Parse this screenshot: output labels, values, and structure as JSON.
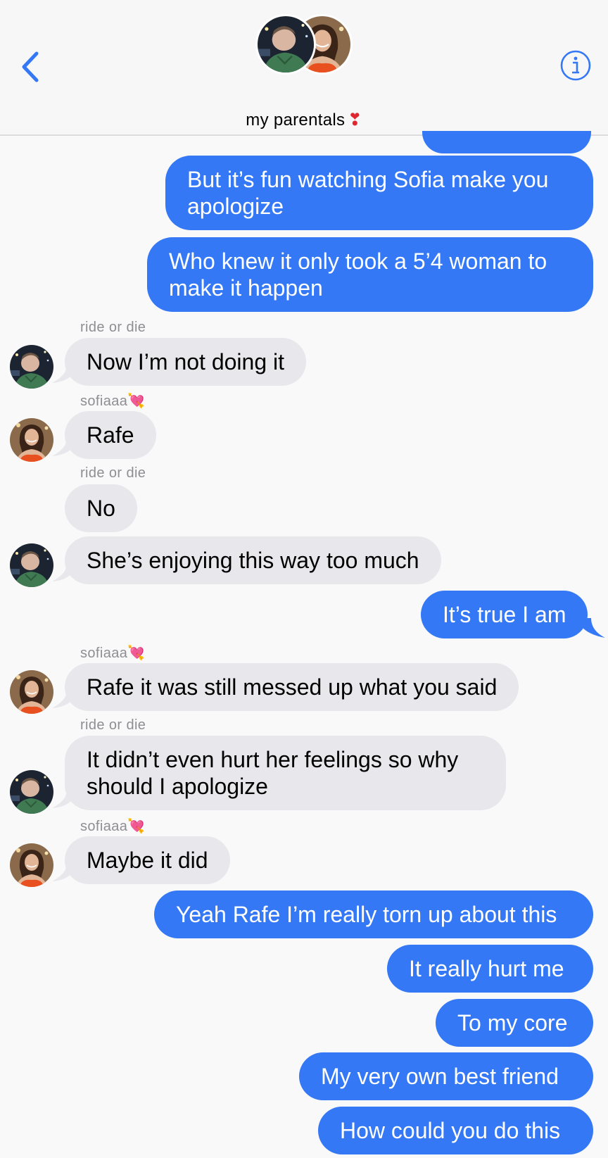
{
  "header": {
    "group_name": "my parentals",
    "group_emoji": "❣",
    "back_icon": "chevron-left-icon",
    "info_icon": "info-icon"
  },
  "colors": {
    "outgoing_bubble": "#3478f6",
    "incoming_bubble": "#e8e8ec",
    "accent": "#3478f6",
    "sender_label": "#8e8e93"
  },
  "messages": [
    {
      "direction": "out",
      "text": "But it’s fun watching Sofia make you apologize"
    },
    {
      "direction": "out",
      "text": "Who knew it only took a 5’4 woman to make it happen"
    },
    {
      "direction": "in",
      "sender": "ride or die",
      "text": "Now I’m not doing it"
    },
    {
      "direction": "in",
      "sender": "sofiaaa",
      "sender_emoji": "💘",
      "text": "Rafe"
    },
    {
      "direction": "in",
      "sender": "ride or die",
      "text": "No"
    },
    {
      "direction": "in",
      "text": "She’s enjoying this way too much"
    },
    {
      "direction": "out",
      "text": "It’s true I am"
    },
    {
      "direction": "in",
      "sender": "sofiaaa",
      "sender_emoji": "💘",
      "text": "Rafe it was still messed up what you said"
    },
    {
      "direction": "in",
      "sender": "ride or die",
      "text": "It didn’t even hurt her feelings so why should I apologize"
    },
    {
      "direction": "in",
      "sender": "sofiaaa",
      "sender_emoji": "💘",
      "text": "Maybe it did"
    },
    {
      "direction": "out",
      "text": "Yeah Rafe I’m really torn up about this"
    },
    {
      "direction": "out",
      "text": "It really hurt me"
    },
    {
      "direction": "out",
      "text": "To my core"
    },
    {
      "direction": "out",
      "text": "My very own best friend"
    },
    {
      "direction": "out",
      "text": "How could you do this"
    }
  ]
}
